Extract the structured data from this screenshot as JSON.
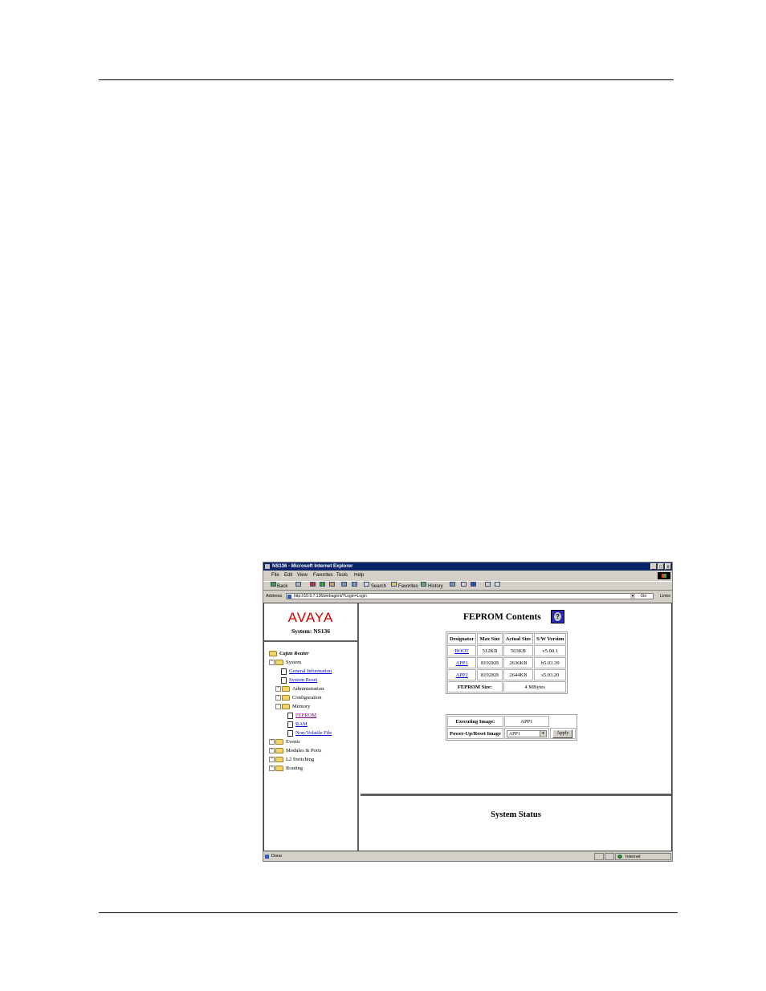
{
  "window": {
    "title": "NS136 - Microsoft Internet Explorer",
    "controls": [
      "_",
      "□",
      "x"
    ]
  },
  "menu": [
    "File",
    "Edit",
    "View",
    "Favorites",
    "Tools",
    "Help"
  ],
  "toolbar": {
    "back": "Back",
    "search": "Search",
    "favorites": "Favorites",
    "history": "History"
  },
  "address": {
    "label": "Address",
    "url": "http://10.0.7.136/webagent/?Login=Login",
    "go": "Go",
    "links": "Links"
  },
  "sidebar": {
    "logo": "AVAYA",
    "system": "System: NS136",
    "tree": {
      "root": "Cajun Router",
      "system": "System",
      "general_information": "General Information",
      "system_reset": "System Reset",
      "administration": "Administration",
      "configuration": "Configuration",
      "memory": "Memory",
      "feprom": "FEPROM",
      "ram": "RAM",
      "nvf": "Non-Volatile File",
      "events": "Events",
      "modules_ports": "Modules & Ports",
      "l2_switching": "L2 Switching",
      "routing": "Routing"
    }
  },
  "main": {
    "title": "FEPROM Contents",
    "table": {
      "headers": [
        "Designator",
        "Max Size",
        "Actual Size",
        "S/W Version"
      ],
      "rows": [
        [
          "BOOT",
          "512KB",
          "503KB",
          "v5.00.1"
        ],
        [
          "APP1",
          "8192KB",
          "2636KB",
          "b5.03.39"
        ],
        [
          "APP2",
          "8192KB",
          "2644KB",
          "s5.03.20"
        ]
      ],
      "size_label": "FEPROM Size:",
      "size_value": "4 MBytes"
    },
    "image": {
      "executing_label": "Executing Image:",
      "executing_value": "APP1",
      "powerup_label": "Power-Up/Reset Image",
      "powerup_value": "APP1",
      "apply": "Apply"
    },
    "status_title": "System Status"
  },
  "statusbar": {
    "text": "Done",
    "zone": "Internet"
  },
  "colors": {
    "titlebar": "#0a246a",
    "link": "#0000cc",
    "visited": "#800080",
    "logo": "#d00000"
  }
}
